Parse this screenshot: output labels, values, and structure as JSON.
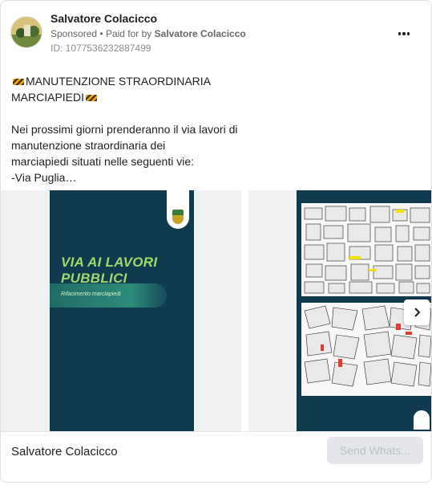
{
  "post": {
    "page_name": "Salvatore Colacicco",
    "sponsored_label": "Sponsored",
    "separator": "•",
    "paid_for_by_label": "Paid for by",
    "paid_for_by_name": "Salvatore Colacicco",
    "ad_id": "ID: 1077536232887499",
    "title_text": "MANUTENZIONE STRAORDINARIA MARCIAPIEDI",
    "body_text": "Nei prossimi giorni prenderanno il via lavori di\nmanutenzione straordinaria dei\nmarciapiedi situati nelle seguenti vie:\n-Via Puglia…"
  },
  "icons": {
    "emoji": "construction-barrier-emoji",
    "more": "more-dots-icon",
    "next": "chevron-right-icon",
    "crest": "municipal-crest-icon"
  },
  "carousel": {
    "slide1": {
      "title": "VIA AI LAVORI PUBBLICI",
      "subtitle": "Rifacimento marciapiedi"
    }
  },
  "footer": {
    "name": "Salvatore Colacicco",
    "cta_label": "Send Whats..."
  },
  "colors": {
    "poster_bg": "#0f3a4f",
    "poster_title": "#9ed96a",
    "cta_bg": "#e4e6eb",
    "cta_text": "#bcc0c4"
  }
}
